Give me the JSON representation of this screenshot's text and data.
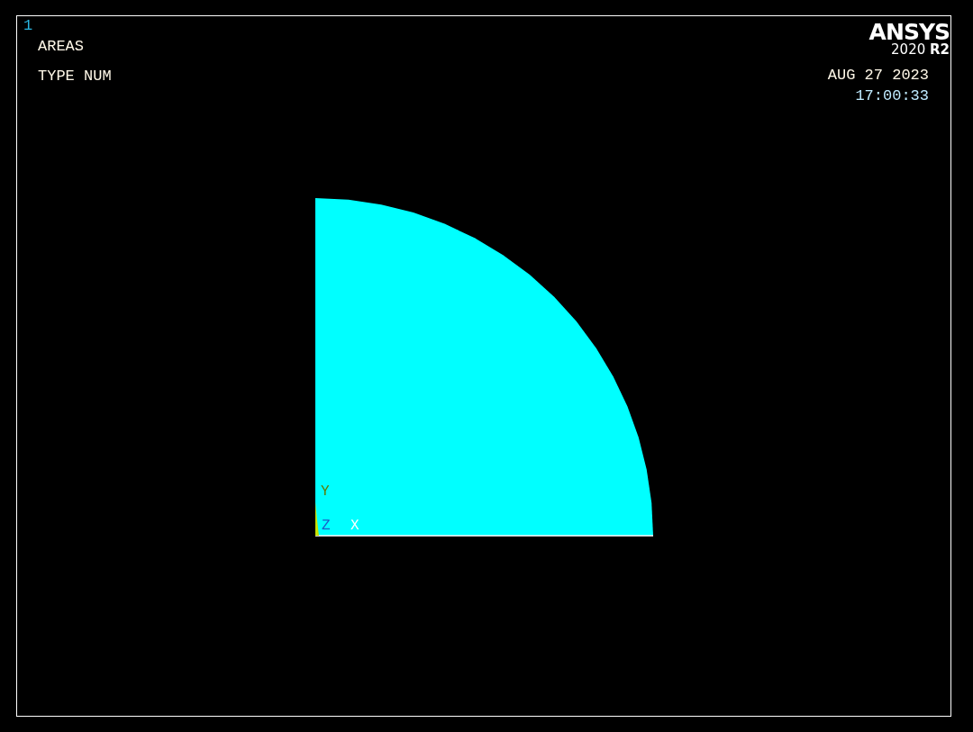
{
  "window_number": "1",
  "plot_titles": [
    "AREAS",
    "TYPE NUM"
  ],
  "logo": {
    "name": "ANSYS",
    "version": "2020 **R2**"
  },
  "date": "AUG 27 2023",
  "time": "17:00:33",
  "triad": [
    {
      "label": "Y",
      "color": "#5f7a00"
    },
    {
      "label": "Z",
      "color": "#1a5fc8"
    },
    {
      "label": "X",
      "color": "#ffffff"
    }
  ]
}
